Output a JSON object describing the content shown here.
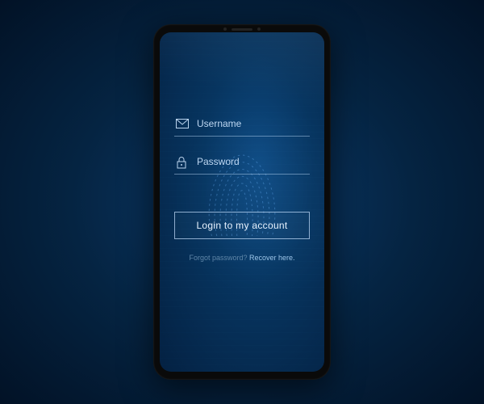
{
  "form": {
    "username_placeholder": "Username",
    "password_placeholder": "Password",
    "login_button_label": "Login to my account",
    "forgot_text": "Forgot password? ",
    "recover_link_text": "Recover here."
  },
  "icons": {
    "username": "envelope-icon",
    "password": "lock-icon"
  },
  "colors": {
    "accent": "#cfe6ff",
    "background_dark": "#042142"
  }
}
